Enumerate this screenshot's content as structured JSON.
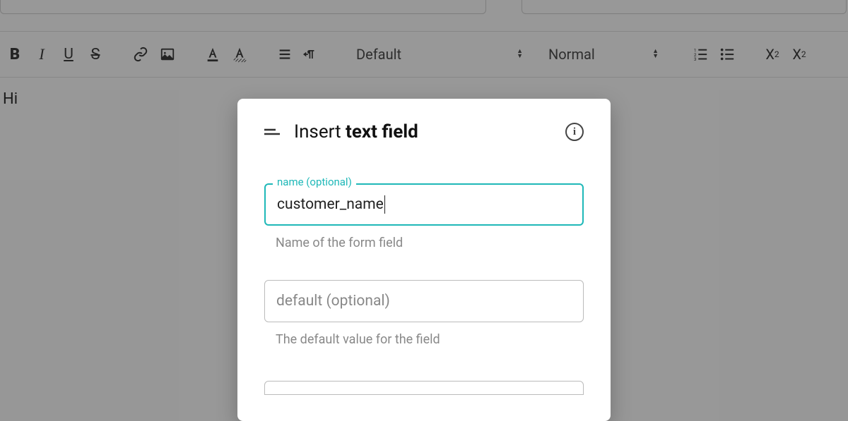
{
  "toolbar": {
    "bold": "B",
    "italic": "I",
    "underline": "U",
    "strike": "S",
    "font_select": "Default",
    "size_select": "Normal",
    "subscript_base": "X",
    "subscript_sub": "2",
    "superscript_base": "X",
    "superscript_sup": "2"
  },
  "editor": {
    "content": "Hi"
  },
  "dialog": {
    "title_prefix": "Insert ",
    "title_bold": "text field",
    "name_field": {
      "label": "name (optional)",
      "value": "customer_name",
      "help": "Name of the form field"
    },
    "default_field": {
      "placeholder": "default (optional)",
      "help": "The default value for the field"
    }
  }
}
